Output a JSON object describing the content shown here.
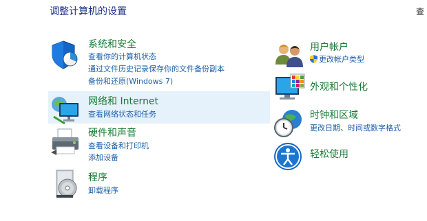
{
  "header": {
    "title": "调整计算机的设置",
    "view_by_label": "查"
  },
  "left_categories": [
    {
      "title": "系统和安全",
      "icon": "security-shield-icon",
      "links": [
        "查看你的计算机状态",
        "通过文件历史记录保存你的文件备份副本",
        "备份和还原(Windows 7)"
      ]
    },
    {
      "title": "网络和 Internet",
      "icon": "network-globe-icon",
      "links": [
        "查看网络状态和任务"
      ]
    },
    {
      "title": "硬件和声音",
      "icon": "printer-icon",
      "links": [
        "查看设备和打印机",
        "添加设备"
      ]
    },
    {
      "title": "程序",
      "icon": "programs-disc-icon",
      "links": [
        "卸载程序"
      ]
    }
  ],
  "right_categories": [
    {
      "title": "用户帐户",
      "icon": "users-icon",
      "links": [
        "更改帐户类型"
      ]
    },
    {
      "title": "外观和个性化",
      "icon": "monitor-palette-icon",
      "links": []
    },
    {
      "title": "时钟和区域",
      "icon": "clock-globe-icon",
      "links": [
        "更改日期、时间或数字格式"
      ]
    },
    {
      "title": "轻松使用",
      "icon": "ease-of-access-icon",
      "links": []
    }
  ],
  "colors": {
    "title_blue": "#1e3287",
    "category_green": "#1a7a35",
    "link_blue": "#1c5fa8",
    "hover_bg": "#e5f1fb"
  }
}
